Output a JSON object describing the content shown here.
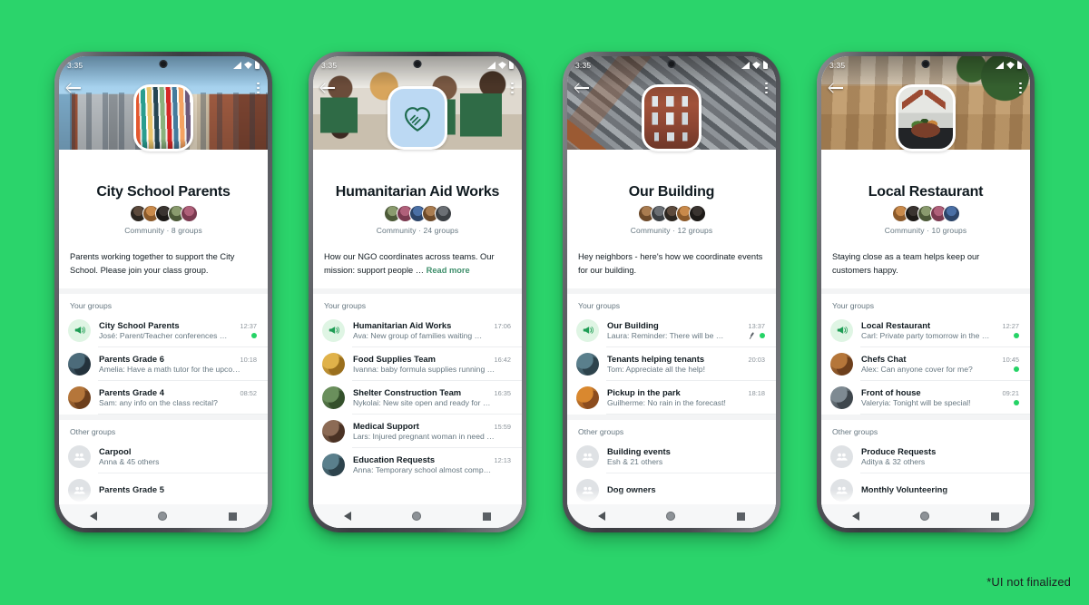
{
  "background_color": "#2BD46B",
  "accent_color": "#25D366",
  "link_color": "#3E8F6B",
  "footnote": "*UI not finalized",
  "status_bar": {
    "time": "3:35",
    "signal_icon": "signal-icon",
    "wifi_icon": "wifi-icon",
    "battery_icon": "battery-icon"
  },
  "nav_bar": {
    "back_icon": "nav-back-icon",
    "home_icon": "nav-home-icon",
    "recents_icon": "nav-recents-icon"
  },
  "top_bar": {
    "back_icon": "back-arrow-icon",
    "menu_icon": "overflow-menu-icon"
  },
  "section_labels": {
    "your_groups": "Your groups",
    "other_groups": "Other groups"
  },
  "phones": [
    {
      "id": "city-school-parents",
      "cover_class": "cv-school",
      "avatar_class": "pic-books",
      "avatar_icon": "books-photo",
      "title": "City School Parents",
      "meta": "Community · 8 groups",
      "description": "Parents working together to support the City School. Please join your class group.",
      "read_more": "",
      "your_groups": [
        {
          "name": "City School Parents",
          "time": "12:37",
          "message": "José: Parent/Teacher conferences …",
          "icon": "announcement-icon",
          "pinned": false,
          "unread": true
        },
        {
          "name": "Parents Grade 6",
          "time": "10:18",
          "message": "Amelia: Have a math tutor for the upco…",
          "icon": "group-photo",
          "pinned": false,
          "unread": false
        },
        {
          "name": "Parents Grade 4",
          "time": "08:52",
          "message": "Sam: any info on the class recital?",
          "icon": "group-photo",
          "pinned": false,
          "unread": false
        }
      ],
      "other_groups": [
        {
          "name": "Carpool",
          "message": "Anna & 45 others",
          "icon": "group-placeholder-icon"
        },
        {
          "name": "Parents Grade 5",
          "message": "",
          "icon": "group-placeholder-icon"
        }
      ]
    },
    {
      "id": "humanitarian-aid-works",
      "cover_class": "cv-volunteers",
      "avatar_class": "pic-logo",
      "avatar_icon": "heart-hand-logo-icon",
      "title": "Humanitarian Aid Works",
      "meta": "Community · 24 groups",
      "description": "How our NGO coordinates across teams. Our mission: support people …",
      "read_more": "Read more",
      "your_groups": [
        {
          "name": "Humanitarian Aid Works",
          "time": "17:06",
          "message": "Ava: New group of families waiting …",
          "icon": "announcement-icon",
          "pinned": false,
          "unread": false
        },
        {
          "name": "Food Supplies Team",
          "time": "16:42",
          "message": "Ivanna: baby formula supplies running …",
          "icon": "group-photo",
          "pinned": false,
          "unread": false
        },
        {
          "name": "Shelter Construction Team",
          "time": "16:35",
          "message": "Nykolai: New site open and ready for …",
          "icon": "group-photo",
          "pinned": false,
          "unread": false
        },
        {
          "name": "Medical Support",
          "time": "15:59",
          "message": "Lars: Injured pregnant woman in need …",
          "icon": "group-photo",
          "pinned": false,
          "unread": false
        },
        {
          "name": "Education Requests",
          "time": "12:13",
          "message": "Anna: Temporary school almost comp…",
          "icon": "group-photo",
          "pinned": false,
          "unread": false
        }
      ],
      "other_groups": []
    },
    {
      "id": "our-building",
      "cover_class": "cv-city",
      "avatar_class": "pic-building",
      "avatar_icon": "building-photo",
      "title": "Our Building",
      "meta": "Community · 12 groups",
      "description": "Hey neighbors - here's how we coordinate events for our building.",
      "read_more": "",
      "your_groups": [
        {
          "name": "Our Building",
          "time": "13:37",
          "message": "Laura: Reminder:  There will be …",
          "icon": "announcement-icon",
          "pinned": true,
          "unread": true
        },
        {
          "name": "Tenants helping tenants",
          "time": "20:03",
          "message": "Tom: Appreciate all the help!",
          "icon": "group-photo",
          "pinned": false,
          "unread": false
        },
        {
          "name": "Pickup in the park",
          "time": "18:18",
          "message": "Guilherme: No rain in the forecast!",
          "icon": "group-photo",
          "pinned": false,
          "unread": false
        }
      ],
      "other_groups": [
        {
          "name": "Building events",
          "message": "Esh & 21 others",
          "icon": "group-placeholder-icon"
        },
        {
          "name": "Dog owners",
          "message": "",
          "icon": "group-placeholder-icon"
        }
      ]
    },
    {
      "id": "local-restaurant",
      "cover_class": "cv-restaurant",
      "avatar_class": "pic-food",
      "avatar_icon": "food-photo",
      "title": "Local Restaurant",
      "meta": "Community · 10 groups",
      "description": "Staying close as a team helps keep our customers happy.",
      "read_more": "",
      "your_groups": [
        {
          "name": "Local Restaurant",
          "time": "12:27",
          "message": "Carl: Private party tomorrow in the …",
          "icon": "announcement-icon",
          "pinned": false,
          "unread": true
        },
        {
          "name": "Chefs Chat",
          "time": "10:45",
          "message": "Alex: Can anyone cover for me?",
          "icon": "group-photo",
          "pinned": false,
          "unread": true
        },
        {
          "name": "Front of house",
          "time": "09:21",
          "message": "Valeryia: Tonight will be special!",
          "icon": "group-photo",
          "pinned": false,
          "unread": true
        }
      ],
      "other_groups": [
        {
          "name": "Produce Requests",
          "message": "Aditya & 32 others",
          "icon": "group-placeholder-icon"
        },
        {
          "name": "Monthly Volunteering",
          "message": "",
          "icon": "group-placeholder-icon"
        }
      ]
    }
  ]
}
